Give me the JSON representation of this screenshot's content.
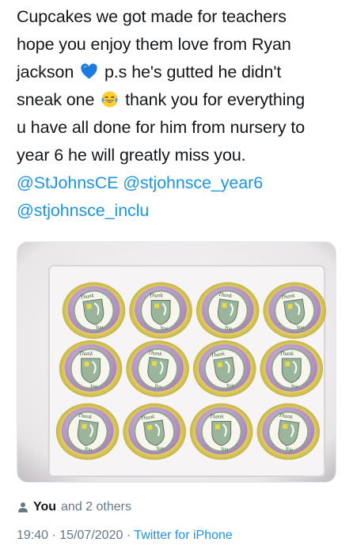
{
  "tweet": {
    "lines": [
      "Cupcakes we got made for teachers",
      "hope you enjoy them love from Ryan",
      "sneak one",
      "thank you for everything",
      "u have all done for him from nursery to",
      "year 6 he will greatly miss you."
    ],
    "line3_before": "jackson",
    "line3_after": "p.s he's gutted he didn't",
    "mentions": [
      "@StJohnsCE",
      "@stjohnsce_year6",
      "@stjohnsce_inclu"
    ],
    "emoji": {
      "heart": "blue-heart-icon",
      "laugh": "tears-of-joy-icon"
    }
  },
  "media": {
    "cupcake_topper_top": "Thank",
    "cupcake_topper_bottom": "You",
    "rows": 3,
    "cols": 4,
    "colors": {
      "box": "#f2f0f1",
      "frosting": "#c9a9d4",
      "liner": "#e3d25a",
      "topper": "#f7f5ee",
      "shield": "#9ab59b"
    }
  },
  "engagement": {
    "you_label": "You",
    "others_label": "and 2 others"
  },
  "meta": {
    "time": "19:40",
    "date": "15/07/2020",
    "separator": "·",
    "source": "Twitter for iPhone"
  },
  "colors": {
    "text": "#14171a",
    "link": "#1b95e0",
    "secondary": "#657786"
  }
}
